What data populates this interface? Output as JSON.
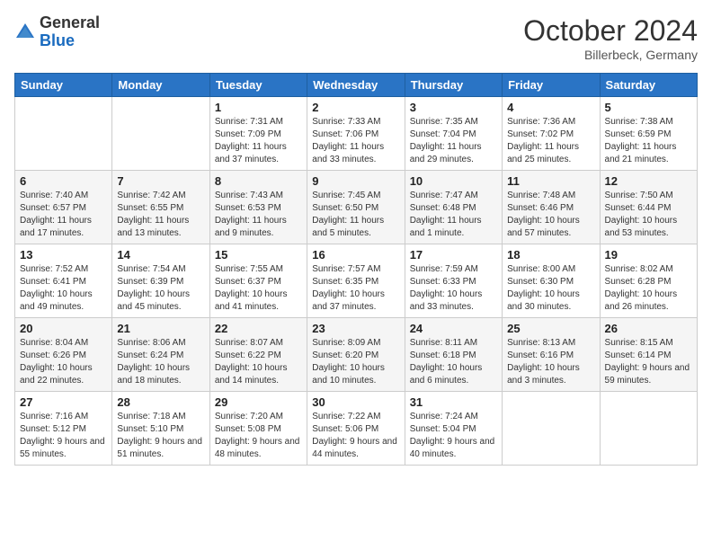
{
  "header": {
    "logo_general": "General",
    "logo_blue": "Blue",
    "month_title": "October 2024",
    "location": "Billerbeck, Germany"
  },
  "weekdays": [
    "Sunday",
    "Monday",
    "Tuesday",
    "Wednesday",
    "Thursday",
    "Friday",
    "Saturday"
  ],
  "weeks": [
    [
      {
        "day": "",
        "sunrise": "",
        "sunset": "",
        "daylight": ""
      },
      {
        "day": "",
        "sunrise": "",
        "sunset": "",
        "daylight": ""
      },
      {
        "day": "1",
        "sunrise": "Sunrise: 7:31 AM",
        "sunset": "Sunset: 7:09 PM",
        "daylight": "Daylight: 11 hours and 37 minutes."
      },
      {
        "day": "2",
        "sunrise": "Sunrise: 7:33 AM",
        "sunset": "Sunset: 7:06 PM",
        "daylight": "Daylight: 11 hours and 33 minutes."
      },
      {
        "day": "3",
        "sunrise": "Sunrise: 7:35 AM",
        "sunset": "Sunset: 7:04 PM",
        "daylight": "Daylight: 11 hours and 29 minutes."
      },
      {
        "day": "4",
        "sunrise": "Sunrise: 7:36 AM",
        "sunset": "Sunset: 7:02 PM",
        "daylight": "Daylight: 11 hours and 25 minutes."
      },
      {
        "day": "5",
        "sunrise": "Sunrise: 7:38 AM",
        "sunset": "Sunset: 6:59 PM",
        "daylight": "Daylight: 11 hours and 21 minutes."
      }
    ],
    [
      {
        "day": "6",
        "sunrise": "Sunrise: 7:40 AM",
        "sunset": "Sunset: 6:57 PM",
        "daylight": "Daylight: 11 hours and 17 minutes."
      },
      {
        "day": "7",
        "sunrise": "Sunrise: 7:42 AM",
        "sunset": "Sunset: 6:55 PM",
        "daylight": "Daylight: 11 hours and 13 minutes."
      },
      {
        "day": "8",
        "sunrise": "Sunrise: 7:43 AM",
        "sunset": "Sunset: 6:53 PM",
        "daylight": "Daylight: 11 hours and 9 minutes."
      },
      {
        "day": "9",
        "sunrise": "Sunrise: 7:45 AM",
        "sunset": "Sunset: 6:50 PM",
        "daylight": "Daylight: 11 hours and 5 minutes."
      },
      {
        "day": "10",
        "sunrise": "Sunrise: 7:47 AM",
        "sunset": "Sunset: 6:48 PM",
        "daylight": "Daylight: 11 hours and 1 minute."
      },
      {
        "day": "11",
        "sunrise": "Sunrise: 7:48 AM",
        "sunset": "Sunset: 6:46 PM",
        "daylight": "Daylight: 10 hours and 57 minutes."
      },
      {
        "day": "12",
        "sunrise": "Sunrise: 7:50 AM",
        "sunset": "Sunset: 6:44 PM",
        "daylight": "Daylight: 10 hours and 53 minutes."
      }
    ],
    [
      {
        "day": "13",
        "sunrise": "Sunrise: 7:52 AM",
        "sunset": "Sunset: 6:41 PM",
        "daylight": "Daylight: 10 hours and 49 minutes."
      },
      {
        "day": "14",
        "sunrise": "Sunrise: 7:54 AM",
        "sunset": "Sunset: 6:39 PM",
        "daylight": "Daylight: 10 hours and 45 minutes."
      },
      {
        "day": "15",
        "sunrise": "Sunrise: 7:55 AM",
        "sunset": "Sunset: 6:37 PM",
        "daylight": "Daylight: 10 hours and 41 minutes."
      },
      {
        "day": "16",
        "sunrise": "Sunrise: 7:57 AM",
        "sunset": "Sunset: 6:35 PM",
        "daylight": "Daylight: 10 hours and 37 minutes."
      },
      {
        "day": "17",
        "sunrise": "Sunrise: 7:59 AM",
        "sunset": "Sunset: 6:33 PM",
        "daylight": "Daylight: 10 hours and 33 minutes."
      },
      {
        "day": "18",
        "sunrise": "Sunrise: 8:00 AM",
        "sunset": "Sunset: 6:30 PM",
        "daylight": "Daylight: 10 hours and 30 minutes."
      },
      {
        "day": "19",
        "sunrise": "Sunrise: 8:02 AM",
        "sunset": "Sunset: 6:28 PM",
        "daylight": "Daylight: 10 hours and 26 minutes."
      }
    ],
    [
      {
        "day": "20",
        "sunrise": "Sunrise: 8:04 AM",
        "sunset": "Sunset: 6:26 PM",
        "daylight": "Daylight: 10 hours and 22 minutes."
      },
      {
        "day": "21",
        "sunrise": "Sunrise: 8:06 AM",
        "sunset": "Sunset: 6:24 PM",
        "daylight": "Daylight: 10 hours and 18 minutes."
      },
      {
        "day": "22",
        "sunrise": "Sunrise: 8:07 AM",
        "sunset": "Sunset: 6:22 PM",
        "daylight": "Daylight: 10 hours and 14 minutes."
      },
      {
        "day": "23",
        "sunrise": "Sunrise: 8:09 AM",
        "sunset": "Sunset: 6:20 PM",
        "daylight": "Daylight: 10 hours and 10 minutes."
      },
      {
        "day": "24",
        "sunrise": "Sunrise: 8:11 AM",
        "sunset": "Sunset: 6:18 PM",
        "daylight": "Daylight: 10 hours and 6 minutes."
      },
      {
        "day": "25",
        "sunrise": "Sunrise: 8:13 AM",
        "sunset": "Sunset: 6:16 PM",
        "daylight": "Daylight: 10 hours and 3 minutes."
      },
      {
        "day": "26",
        "sunrise": "Sunrise: 8:15 AM",
        "sunset": "Sunset: 6:14 PM",
        "daylight": "Daylight: 9 hours and 59 minutes."
      }
    ],
    [
      {
        "day": "27",
        "sunrise": "Sunrise: 7:16 AM",
        "sunset": "Sunset: 5:12 PM",
        "daylight": "Daylight: 9 hours and 55 minutes."
      },
      {
        "day": "28",
        "sunrise": "Sunrise: 7:18 AM",
        "sunset": "Sunset: 5:10 PM",
        "daylight": "Daylight: 9 hours and 51 minutes."
      },
      {
        "day": "29",
        "sunrise": "Sunrise: 7:20 AM",
        "sunset": "Sunset: 5:08 PM",
        "daylight": "Daylight: 9 hours and 48 minutes."
      },
      {
        "day": "30",
        "sunrise": "Sunrise: 7:22 AM",
        "sunset": "Sunset: 5:06 PM",
        "daylight": "Daylight: 9 hours and 44 minutes."
      },
      {
        "day": "31",
        "sunrise": "Sunrise: 7:24 AM",
        "sunset": "Sunset: 5:04 PM",
        "daylight": "Daylight: 9 hours and 40 minutes."
      },
      {
        "day": "",
        "sunrise": "",
        "sunset": "",
        "daylight": ""
      },
      {
        "day": "",
        "sunrise": "",
        "sunset": "",
        "daylight": ""
      }
    ]
  ]
}
